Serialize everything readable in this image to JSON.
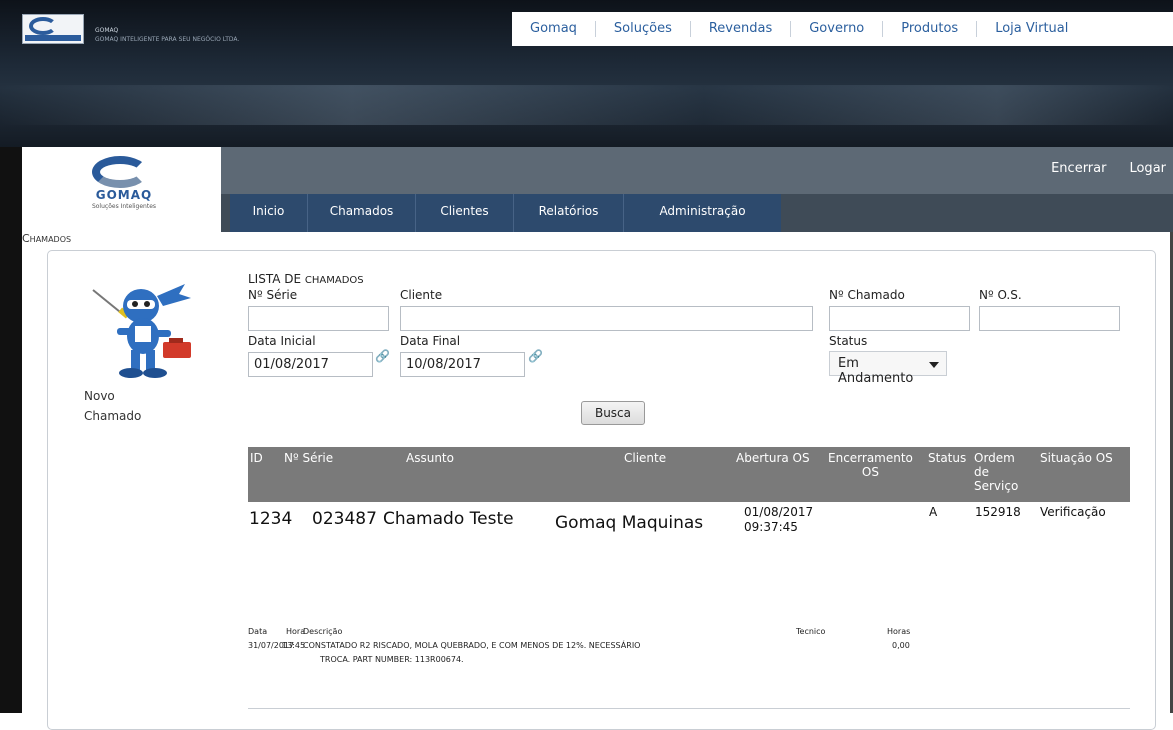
{
  "banner": {
    "brand_line1": "GOMAQ",
    "brand_line2": "GOMAQ INTELIGENTE PARA SEU NEGÓCIO LTDA.",
    "nav": [
      "Gomaq",
      "Soluções",
      "Revendas",
      "Governo",
      "Produtos",
      "Loja Virtual"
    ]
  },
  "side_logo": {
    "word": "GOMAQ",
    "tagline": "Soluções Inteligentes"
  },
  "header_actions": {
    "encerrar": "Encerrar",
    "logar": "Logar"
  },
  "menu": [
    "Inicio",
    "Chamados",
    "Clientes",
    "Relatórios",
    "Administração"
  ],
  "section_label": "Chamados",
  "sidebar": {
    "novo_line1": "Novo",
    "novo_line2": "Chamado"
  },
  "form": {
    "title_big": "Lista de",
    "title_small": "chamados",
    "serie_label": "Nº Série",
    "serie_value": "",
    "cliente_label": "Cliente",
    "cliente_value": "",
    "chamado_label": "Nº Chamado",
    "chamado_value": "",
    "os_label": "Nº O.S.",
    "os_value": "",
    "data_inicial_label": "Data Inicial",
    "data_inicial_value": "01/08/2017",
    "data_final_label": "Data Final",
    "data_final_value": "10/08/2017",
    "status_label": "Status",
    "status_value": "Em Andamento",
    "busca_label": "Busca"
  },
  "table": {
    "headers": {
      "id": "ID",
      "serie": "Nº Série",
      "assunto": "Assunto",
      "cliente": "Cliente",
      "abertura": "Abertura OS",
      "encerramento_1": "Encerramento",
      "encerramento_2": "OS",
      "status": "Status",
      "ordem_1": "Ordem",
      "ordem_2": "de",
      "ordem_3": "Serviço",
      "situacao": "Situação OS"
    },
    "row": {
      "id": "1234",
      "serie": "023487",
      "assunto": "Chamado Teste",
      "cliente": "Gomaq Maquinas",
      "abertura_date": "01/08/2017",
      "abertura_time": "09:37:45",
      "status": "A",
      "ordem": "152918",
      "situacao": "Verificação"
    }
  },
  "history": {
    "h_data": "Data",
    "h_hora": "Hora",
    "h_descricao": "Descrição",
    "h_tecnico": "Tecnico",
    "h_horas": "Horas",
    "data": "31/07/2017",
    "hora": "13:45",
    "descricao_1": "CONSTATADO R2 RISCADO, MOLA QUEBRADO, E COM MENOS DE 12%. NECESSÁRIO",
    "descricao_2": "TROCA. PART NUMBER: 113R00674.",
    "horas": "0,00"
  },
  "colors": {
    "brand_blue": "#2b5f9e",
    "menu_bg": "#2d4a6d",
    "table_head": "#7a7a7a"
  }
}
